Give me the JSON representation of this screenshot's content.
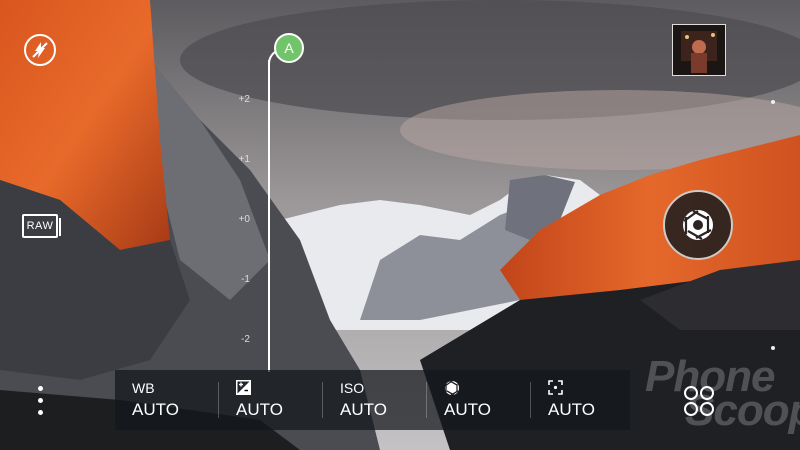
{
  "camera": {
    "flash_icon": "flash-off-icon",
    "raw_label": "RAW",
    "ev": {
      "knob_label": "A",
      "ticks": [
        "+2",
        "+1",
        "+0",
        "-1",
        "-2"
      ]
    },
    "settings": [
      {
        "label": "WB",
        "value": "AUTO",
        "icon": null
      },
      {
        "label": "",
        "value": "AUTO",
        "icon": "exposure-icon"
      },
      {
        "label": "ISO",
        "value": "AUTO",
        "icon": null
      },
      {
        "label": "",
        "value": "AUTO",
        "icon": "shutter-speed-icon"
      },
      {
        "label": "",
        "value": "AUTO",
        "icon": "focus-icon"
      }
    ],
    "watermark": [
      "Phone",
      "Scoop"
    ],
    "colors": {
      "ev_knob": "#72c46a",
      "settings_bar": "rgba(20,22,26,0.72)"
    }
  }
}
